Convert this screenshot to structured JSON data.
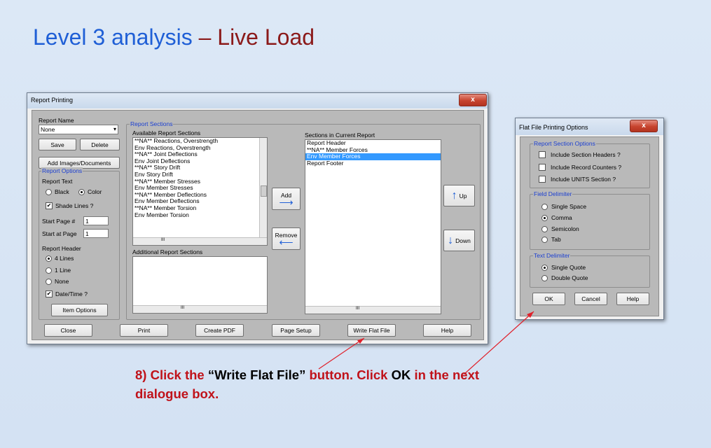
{
  "slide": {
    "title_part1": "Level 3 analysis",
    "title_dash": " – ",
    "title_part2": "Live Load",
    "caption": {
      "step": "8) Click the ",
      "quote_open": "“",
      "button_name": "Write Flat File",
      "quote_close": "”",
      "mid": " button. Click ",
      "ok": "OK",
      "end": " in the next",
      "line2": "dialogue box."
    }
  },
  "report_printing": {
    "title": "Report Printing",
    "close_glyph": "x",
    "report_name_label": "Report Name",
    "report_name_value": "None",
    "save": "Save",
    "delete": "Delete",
    "add_images": "Add Images/Documents",
    "report_options_title": "Report Options",
    "report_text_label": "Report Text",
    "black": "Black",
    "color": "Color",
    "shade_lines": "Shade Lines ?",
    "start_page_label": "Start Page #",
    "start_page_value": "1",
    "start_at_page_label": "Start at Page",
    "start_at_page_value": "1",
    "report_header_label": "Report Header",
    "lines4": "4 Lines",
    "line1": "1 Line",
    "none": "None",
    "datetime": "Date/Time ?",
    "item_options": "Item Options",
    "report_sections_title": "Report Sections",
    "available_label": "Available Report Sections",
    "available_items": [
      "**NA** Reactions, Overstrength",
      "Env Reactions, Overstrength",
      "**NA** Joint Deflections",
      "Env Joint Deflections",
      "**NA** Story Drift",
      "Env Story Drift",
      "**NA** Member Stresses",
      "Env Member Stresses",
      "**NA** Member Deflections",
      "Env Member Deflections",
      "**NA** Member Torsion",
      "Env Member Torsion"
    ],
    "add": "Add",
    "remove": "Remove",
    "additional_label": "Additional Report Sections",
    "current_label": "Sections in Current Report",
    "current_items": [
      "Report Header",
      "**NA** Member Forces",
      "Env Member Forces",
      "Report Footer"
    ],
    "selected_index": 2,
    "up": "Up",
    "down": "Down",
    "bottom_buttons": [
      "Close",
      "Print",
      "Create PDF",
      "Page Setup",
      "Write Flat File",
      "Help"
    ],
    "scroll_grip": "III"
  },
  "flat_file": {
    "title": "Flat File Printing Options",
    "close_glyph": "x",
    "section_options_title": "Report Section Options",
    "include_headers": "Include Section Headers ?",
    "include_counters": "Include Record Counters ?",
    "include_units": "Include UNITS Section ?",
    "field_delim_title": "Field Delimiter",
    "single_space": "Single Space",
    "comma": "Comma",
    "semicolon": "Semicolon",
    "tab": "Tab",
    "text_delim_title": "Text Delimiter",
    "single_quote": "Single Quote",
    "double_quote": "Double Quote",
    "ok": "OK",
    "cancel": "Cancel",
    "help": "Help"
  },
  "colors": {
    "title_blue": "#1f5fd6",
    "title_red": "#8b1a1a",
    "caption_red": "#c0121a",
    "arrow_red": "#e0202a",
    "selection_blue": "#3399ff",
    "group_title_blue": "#1b3fd1"
  }
}
